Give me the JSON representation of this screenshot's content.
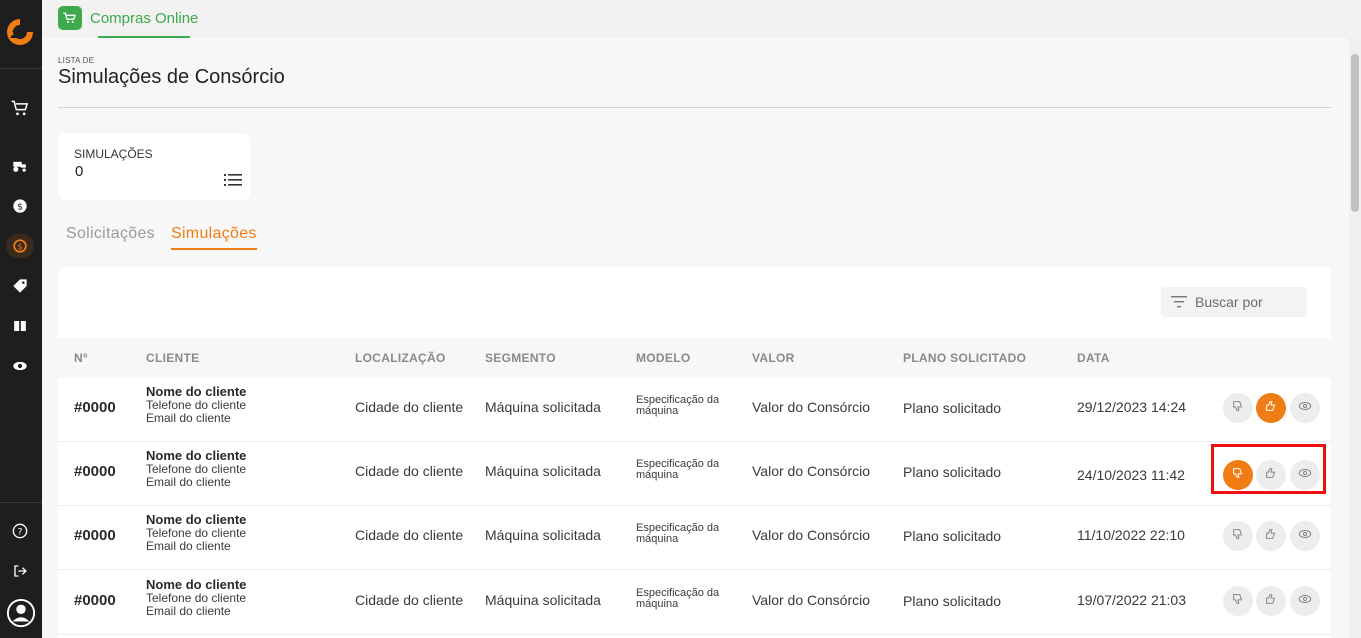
{
  "app": {
    "top_tab_label": "Compras Online"
  },
  "colors": {
    "accent": "#f07c14",
    "green": "#3daa4c",
    "sidebar": "#1e1e1e",
    "highlight": "#e11111"
  },
  "sidebar": {
    "icons": [
      "logo-icon",
      "cart-icon",
      "tractor-icon",
      "dollar-coin-icon",
      "consortium-icon",
      "tag-icon",
      "ticket-icon",
      "eye-icon",
      "help-icon",
      "logout-icon",
      "user-avatar-icon"
    ]
  },
  "page": {
    "overline": "LISTA DE",
    "title": "Simulações de Consórcio"
  },
  "stats": {
    "label": "SIMULAÇÕES",
    "value": "0"
  },
  "tabs": [
    {
      "label": "Solicitações",
      "active": false
    },
    {
      "label": "Simulações",
      "active": true
    }
  ],
  "search": {
    "placeholder": "Buscar por"
  },
  "table": {
    "headers": [
      "Nº",
      "CLIENTE",
      "LOCALIZAÇÃO",
      "SEGMENTO",
      "MODELO",
      "VALOR",
      "PLANO SOLICITADO",
      "DATA"
    ],
    "rows": [
      {
        "num": "#0000",
        "client_name": "Nome do cliente",
        "client_phone": "Telefone do cliente",
        "client_email": "Email do cliente",
        "location": "Cidade do cliente",
        "segment": "Máquina solicitada",
        "model_line1": "Especificação da",
        "model_line2": "máquina",
        "value": "Valor do Consórcio",
        "plan": "Plano solicitado",
        "date": "29/12/2023 14:24",
        "status": "approved"
      },
      {
        "num": "#0000",
        "client_name": "Nome do cliente",
        "client_phone": "Telefone do cliente",
        "client_email": "Email do cliente",
        "location": "Cidade do cliente",
        "segment": "Máquina solicitada",
        "model_line1": "Especificação da",
        "model_line2": "máquina",
        "value": "Valor do Consórcio",
        "plan": "Plano solicitado",
        "date": "24/10/2023 11:42",
        "status": "rejected"
      },
      {
        "num": "#0000",
        "client_name": "Nome do cliente",
        "client_phone": "Telefone do cliente",
        "client_email": "Email do cliente",
        "location": "Cidade do cliente",
        "segment": "Máquina solicitada",
        "model_line1": "Especificação da",
        "model_line2": "máquina",
        "value": "Valor do Consórcio",
        "plan": "Plano solicitado",
        "date": "11/10/2022 22:10",
        "status": "pending"
      },
      {
        "num": "#0000",
        "client_name": "Nome do cliente",
        "client_phone": "Telefone do cliente",
        "client_email": "Email do cliente",
        "location": "Cidade do cliente",
        "segment": "Máquina solicitada",
        "model_line1": "Especificação da",
        "model_line2": "máquina",
        "value": "Valor do Consórcio",
        "plan": "Plano solicitado",
        "date": "19/07/2022 21:03",
        "status": "pending"
      }
    ]
  }
}
